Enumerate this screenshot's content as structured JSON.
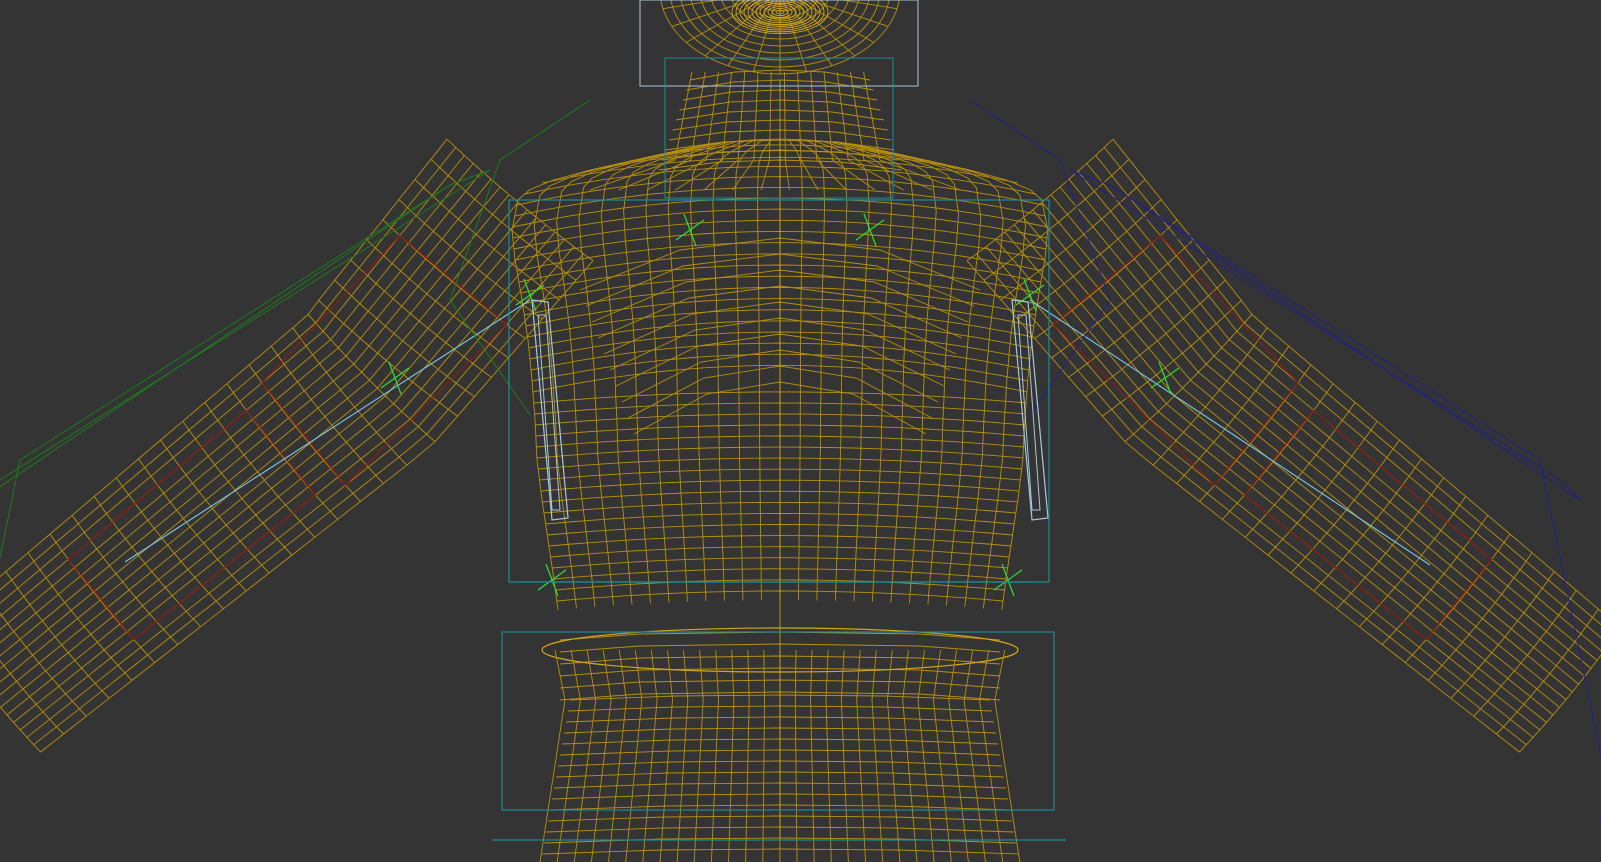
{
  "viewport": {
    "view_mode": "wireframe",
    "background_color": "#343434"
  },
  "colors": {
    "mesh_wire": "#b7900e",
    "mesh_wire_light": "#d4a817",
    "bone_link": "#7cc8ea",
    "bone_box": "#1f8a95",
    "bone_box_light": "#a8c8dc",
    "gizmo_green": "#1e7a1e",
    "gizmo_green_bright": "#33dd33",
    "gizmo_blue": "#222288",
    "envelope_red": "#8a1c16"
  },
  "objects": [
    {
      "name": "character-body-mesh",
      "type": "wireframe-mesh"
    },
    {
      "name": "head-bone-box",
      "type": "bounding-box"
    },
    {
      "name": "neck-bone-box",
      "type": "bounding-box"
    },
    {
      "name": "chest-bone-box",
      "type": "bounding-box"
    },
    {
      "name": "pelvis-bone-box",
      "type": "bounding-box"
    },
    {
      "name": "left-upperarm-envelope",
      "type": "envelope"
    },
    {
      "name": "right-upperarm-envelope",
      "type": "envelope"
    },
    {
      "name": "left-arm-bone-gizmo",
      "type": "bone"
    },
    {
      "name": "right-arm-bone-gizmo",
      "type": "bone"
    }
  ]
}
